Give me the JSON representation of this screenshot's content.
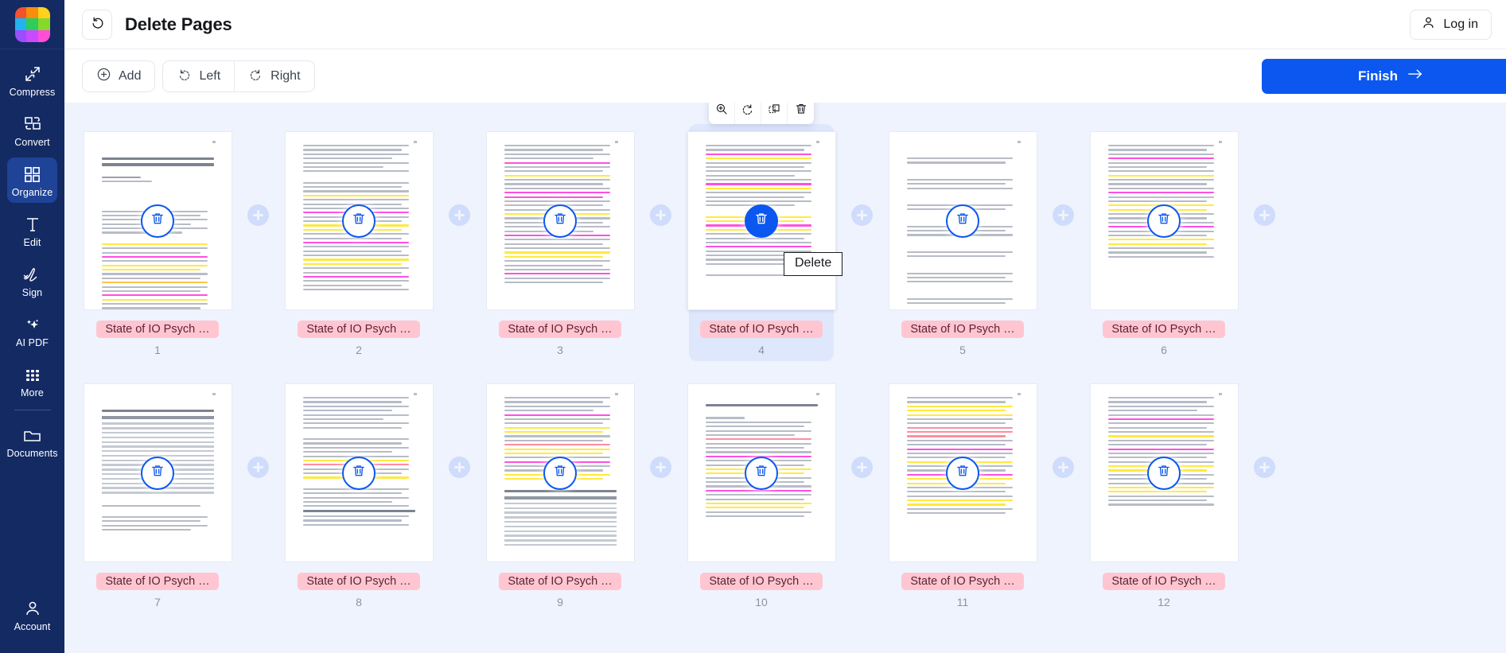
{
  "sidebar": {
    "logo_colors": [
      "#f4512c",
      "#f98d0c",
      "#ffd21e",
      "#22b3f0",
      "#2ecc5a",
      "#86d82a",
      "#9b4dff",
      "#c84bff",
      "#ff4fd8"
    ],
    "items": [
      {
        "label": "Compress",
        "icon": "compress-icon",
        "active": false
      },
      {
        "label": "Convert",
        "icon": "convert-icon",
        "active": false
      },
      {
        "label": "Organize",
        "icon": "organize-icon",
        "active": true
      },
      {
        "label": "Edit",
        "icon": "edit-icon",
        "active": false
      },
      {
        "label": "Sign",
        "icon": "sign-icon",
        "active": false
      },
      {
        "label": "AI PDF",
        "icon": "ai-sparkle-icon",
        "active": false
      },
      {
        "label": "More",
        "icon": "grid-dots-icon",
        "active": false
      }
    ],
    "documents": {
      "label": "Documents",
      "icon": "folder-icon"
    },
    "account": {
      "label": "Account",
      "icon": "user-icon"
    }
  },
  "topbar": {
    "undo_icon": "undo-icon",
    "title": "Delete Pages",
    "login_label": "Log in",
    "login_icon": "user-icon"
  },
  "toolbar": {
    "add_label": "Add",
    "add_icon": "plus-circle-icon",
    "left_label": "Left",
    "left_icon": "rotate-left-icon",
    "right_label": "Right",
    "right_icon": "rotate-right-icon",
    "finish_label": "Finish",
    "finish_arrow": "arrow-right-icon",
    "finish_color": "#0b57f0"
  },
  "hover_tools": [
    {
      "name": "zoom-in-icon",
      "title": "Zoom"
    },
    {
      "name": "rotate-right-icon",
      "title": "Rotate"
    },
    {
      "name": "duplicate-icon",
      "title": "Duplicate"
    },
    {
      "name": "trash-icon",
      "title": "Delete"
    }
  ],
  "tooltip": {
    "text": "Delete"
  },
  "document": {
    "label_text": "State of IO Psych …",
    "label_color": "#ffc6d2",
    "delete_badge_icon": "trash-icon",
    "insert_icon": "plus-icon"
  },
  "pages": [
    {
      "number": "1",
      "label": "State of IO Psych …",
      "selected": false
    },
    {
      "number": "2",
      "label": "State of IO Psych …",
      "selected": false
    },
    {
      "number": "3",
      "label": "State of IO Psych …",
      "selected": false
    },
    {
      "number": "4",
      "label": "State of IO Psych …",
      "selected": true
    },
    {
      "number": "5",
      "label": "State of IO Psych …",
      "selected": false
    },
    {
      "number": "6",
      "label": "State of IO Psych …",
      "selected": false
    },
    {
      "number": "7",
      "label": "State of IO Psych …",
      "selected": false
    },
    {
      "number": "8",
      "label": "State of IO Psych …",
      "selected": false
    },
    {
      "number": "9",
      "label": "State of IO Psych …",
      "selected": false
    },
    {
      "number": "10",
      "label": "State of IO Psych …",
      "selected": false
    },
    {
      "number": "11",
      "label": "State of IO Psych …",
      "selected": false
    },
    {
      "number": "12",
      "label": "State of IO Psych …",
      "selected": false
    }
  ]
}
